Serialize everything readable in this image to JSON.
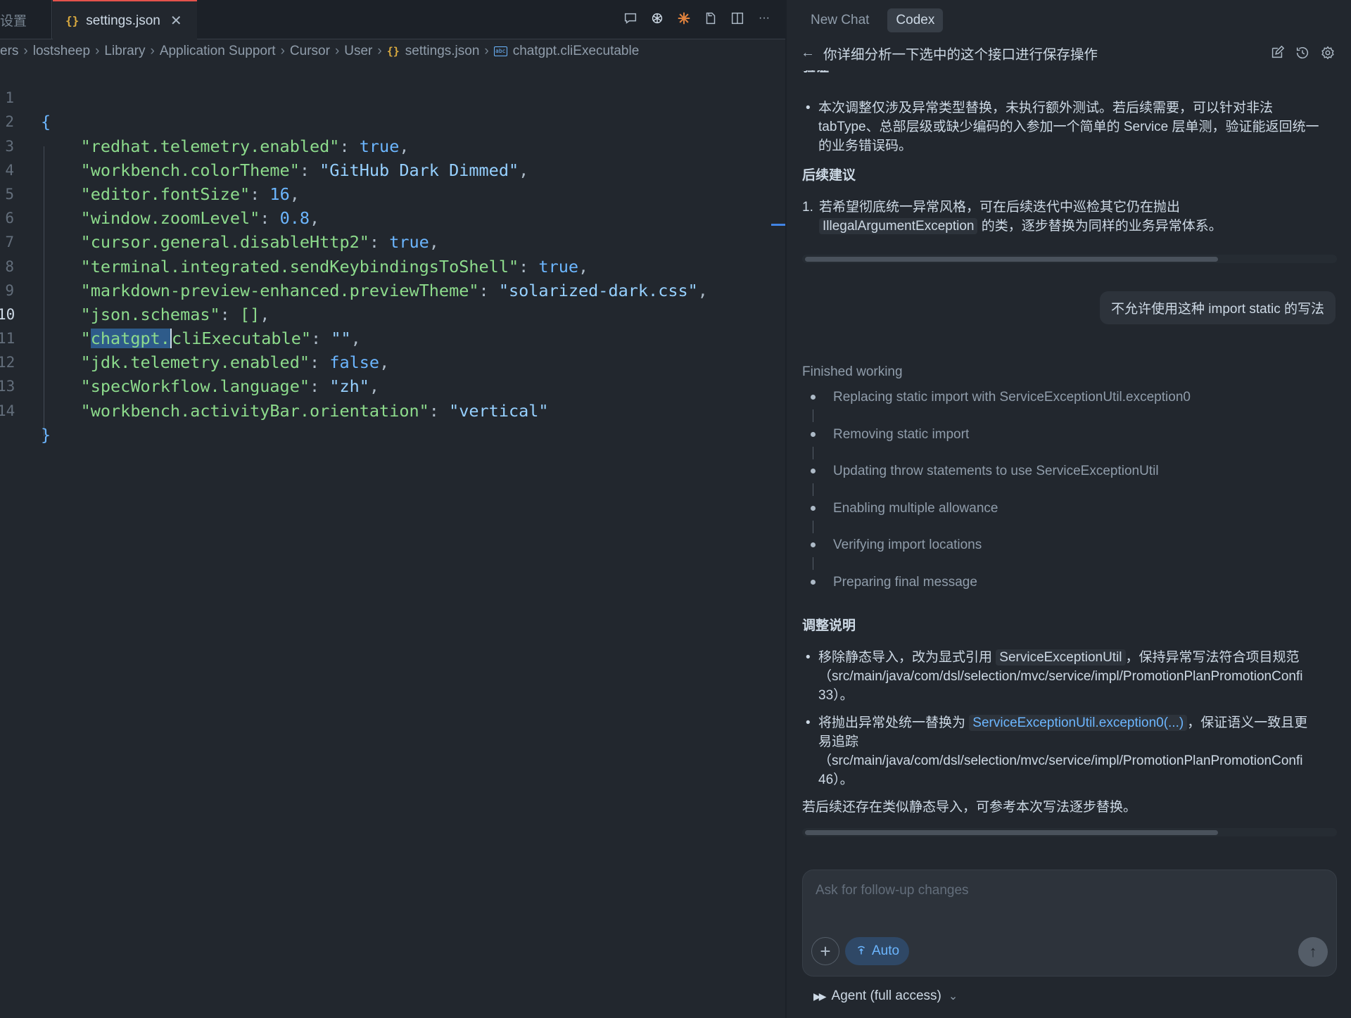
{
  "editor": {
    "tabs": [
      {
        "label": "设置"
      },
      {
        "label": "settings.json",
        "icon": "{}"
      }
    ],
    "close_glyph": "✕",
    "breadcrumb": {
      "items": [
        "ers",
        "lostsheep",
        "Library",
        "Application Support",
        "Cursor",
        "User",
        "settings.json",
        "chatgpt.cliExecutable"
      ],
      "file_icon": "{}",
      "separator": "›"
    },
    "lines": [
      {
        "n": "1"
      },
      {
        "n": "2"
      },
      {
        "n": "3"
      },
      {
        "n": "4"
      },
      {
        "n": "5"
      },
      {
        "n": "6"
      },
      {
        "n": "7"
      },
      {
        "n": "8"
      },
      {
        "n": "9"
      },
      {
        "n": "10"
      },
      {
        "n": "11"
      },
      {
        "n": "12"
      },
      {
        "n": "13"
      },
      {
        "n": "14"
      }
    ],
    "code": {
      "open": "{",
      "close": "}",
      "entries": [
        {
          "key": "\"redhat.telemetry.enabled\"",
          "value": "true",
          "type": "bool"
        },
        {
          "key": "\"workbench.colorTheme\"",
          "value": "\"GitHub Dark Dimmed\"",
          "type": "string"
        },
        {
          "key": "\"editor.fontSize\"",
          "value": "16",
          "type": "number"
        },
        {
          "key": "\"window.zoomLevel\"",
          "value": "0.8",
          "type": "number"
        },
        {
          "key": "\"cursor.general.disableHttp2\"",
          "value": "true",
          "type": "bool"
        },
        {
          "key": "\"terminal.integrated.sendKeybindingsToShell\"",
          "value": "true",
          "type": "bool"
        },
        {
          "key": "\"markdown-preview-enhanced.previewTheme\"",
          "value": "\"solarized-dark.css\"",
          "type": "string"
        },
        {
          "key": "\"json.schemas\"",
          "value": "[]",
          "type": "array"
        },
        {
          "key_quote": "\"",
          "key_sel": "chatgpt.",
          "key_rest": "cliExecutable\"",
          "value": "\"\"",
          "type": "string"
        },
        {
          "key": "\"jdk.telemetry.enabled\"",
          "value": "false",
          "type": "bool"
        },
        {
          "key": "\"specWorkflow.language\"",
          "value": "\"zh\"",
          "type": "string"
        },
        {
          "key": "\"workbench.activityBar.orientation\"",
          "value": "\"vertical\"",
          "type": "string",
          "last": true
        }
      ]
    },
    "active_line": "10",
    "toolbar_icons": [
      "chat-icon",
      "openai-icon",
      "claude-icon",
      "open-changes-icon",
      "split-editor-icon",
      "more-icon"
    ],
    "more_glyph": "···"
  },
  "panel": {
    "tabs": [
      {
        "label": "New Chat",
        "active": false
      },
      {
        "label": "Codex",
        "active": true
      }
    ],
    "back_glyph": "←",
    "thread_title": "你详细分析一下选中的这个接口进行保存操作",
    "clipped_heading": "验证",
    "bullet_1": {
      "line1": "本次调整仅涉及异常类型替换，未执行额外测试。若后续需要，可以针对非法",
      "line2": "tabType、总部层级或缺少编码的入参加一个简单的 Service 层单测，验证能返回统一",
      "line3": "的业务错误码。"
    },
    "heading_followup": "后续建议",
    "followup": {
      "num": "1.",
      "line1": "若希望彻底统一异常风格，可在后续迭代中巡检其它仍在抛出",
      "code": "IllegalArgumentException",
      "line2_rest": " 的类，逐步替换为同样的业务异常体系。"
    },
    "user_message": "不允许使用这种 import static 的写法",
    "finished_label": "Finished working",
    "steps": [
      "Replacing static import with ServiceExceptionUtil.exception0",
      "Removing static import",
      "Updating throw statements to use ServiceExceptionUtil",
      "Enabling multiple allowance",
      "Verifying import locations",
      "Preparing final message"
    ],
    "heading_adjust": "调整说明",
    "adjust_1": {
      "pre": "移除静态导入，改为显式引用 ",
      "code": "ServiceExceptionUtil",
      "post": "，保持异常写法符合项目规范",
      "path": "（src/main/java/com/dsl/selection/mvc/service/impl/PromotionPlanPromotionConfi",
      "tail": "33）。"
    },
    "adjust_2": {
      "pre": "将抛出异常处统一替换为 ",
      "link": "ServiceExceptionUtil.exception0(...)",
      "post": "，保证语义一致且更",
      "line2": "易追踪",
      "path": "（src/main/java/com/dsl/selection/mvc/service/impl/PromotionPlanPromotionConfi",
      "tail": "46）。"
    },
    "closing": "若后续还存在类似静态导入，可参考本次写法逐步替换。",
    "scroll_fraction": 0.78,
    "composer": {
      "placeholder": "Ask for follow-up changes",
      "add_glyph": "+",
      "auto_label": "Auto",
      "send_glyph": "↑"
    },
    "agent_mode": {
      "label": "Agent (full access)",
      "icon_glyph": "▶▶",
      "chevron": "⌄"
    }
  },
  "colors": {
    "background": "#22272e",
    "key": "#8ddb8c",
    "string": "#96d0ff",
    "keyword": "#6cb6ff",
    "accent_tab": "#e5534b",
    "link": "#6cb6ff"
  }
}
